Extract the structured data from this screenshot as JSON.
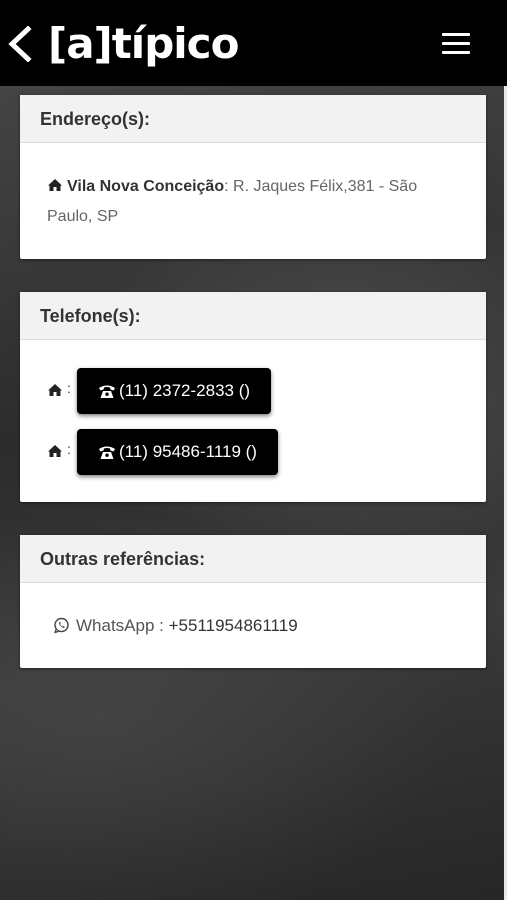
{
  "header": {
    "logo_text": "[a]típico",
    "back_icon": "chevron-left-icon",
    "menu_icon": "hamburger-menu-icon"
  },
  "address_card": {
    "title": "Endereço(s):",
    "neighborhood": "Vila Nova Conceição",
    "separator": ":",
    "address": " R. Jaques Félix,381 - São Paulo, SP"
  },
  "phones_card": {
    "title": "Telefone(s):",
    "items": [
      {
        "colon": ":",
        "label": "(11) 2372-2833 ()"
      },
      {
        "colon": ":",
        "label": "(11) 95486-1119 ()"
      }
    ]
  },
  "refs_card": {
    "title": "Outras referências:",
    "whatsapp_label": "WhatsApp : ",
    "whatsapp_number": "+5511954861119"
  },
  "colors": {
    "header_bg": "#000000",
    "card_bg": "#ffffff",
    "card_header_bg": "#f2f2f2",
    "phone_button_bg": "#000000"
  }
}
